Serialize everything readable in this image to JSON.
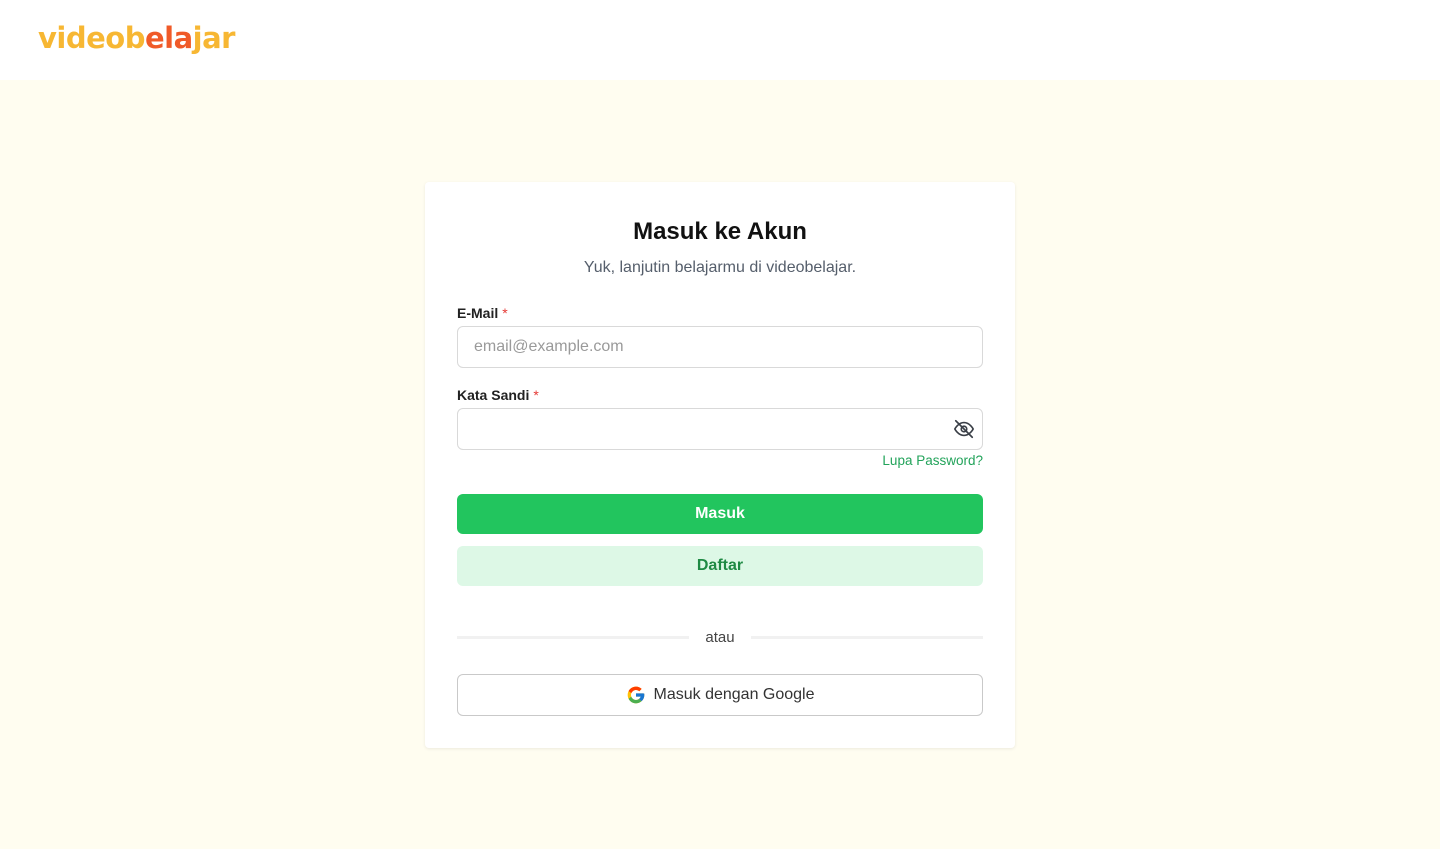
{
  "header": {
    "logo": {
      "part1": "videob",
      "part2": "ela",
      "part3": "jar"
    }
  },
  "login": {
    "title": "Masuk ke Akun",
    "subtitle": "Yuk, lanjutin belajarmu di videobelajar.",
    "email": {
      "label": "E-Mail",
      "required_mark": "*",
      "placeholder": "email@example.com",
      "value": ""
    },
    "password": {
      "label": "Kata Sandi",
      "required_mark": "*",
      "value": "",
      "toggle_icon": "eye-off-icon"
    },
    "forgot_label": "Lupa Password?",
    "submit_label": "Masuk",
    "register_label": "Daftar",
    "divider_label": "atau",
    "google_label": "Masuk dengan Google"
  },
  "colors": {
    "primary": "#22c55e",
    "secondary_bg": "#ddf8e6",
    "page_bg": "#fffdf0",
    "logo_yellow": "#f7b733",
    "logo_orange": "#f05a28"
  }
}
